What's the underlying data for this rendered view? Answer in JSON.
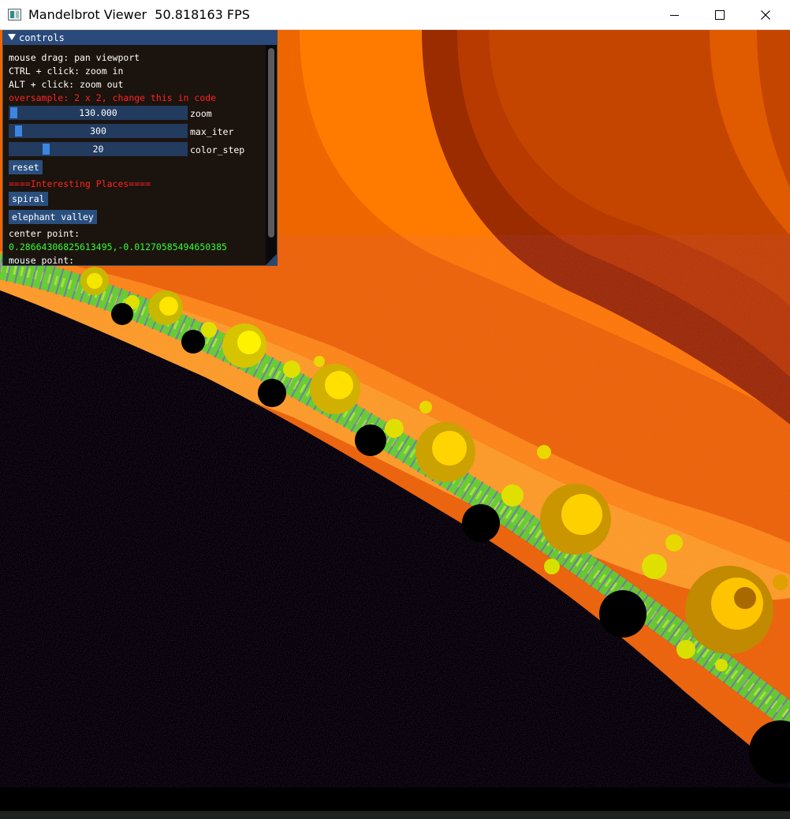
{
  "window": {
    "title": "Mandelbrot Viewer  50.818163 FPS"
  },
  "controls": {
    "title": "controls",
    "help_lines": [
      "mouse drag: pan viewport",
      "CTRL + click: zoom in",
      "ALT + click: zoom out"
    ],
    "oversample_note": "oversample: 2 x 2, change this in code",
    "sliders": [
      {
        "label": "zoom",
        "value": "130.000",
        "fraction": 0.0
      },
      {
        "label": "max_iter",
        "value": "300",
        "fraction": 0.04
      },
      {
        "label": "color_step",
        "value": "20",
        "fraction": 0.2
      }
    ],
    "reset_label": "reset",
    "places_header": "====Interesting Places====",
    "places": [
      "spiral",
      "elephant valley"
    ],
    "center_label": "center point:",
    "center_value": "0.28664306825613495,-0.01270585494650385",
    "mouse_label": "mouse point:"
  },
  "colors": {
    "panel_header": "#294a7a",
    "slider_track": "#223b5e",
    "slider_grab": "#3d85e0",
    "warning_text": "#ff2222",
    "value_text": "#33ff33"
  }
}
